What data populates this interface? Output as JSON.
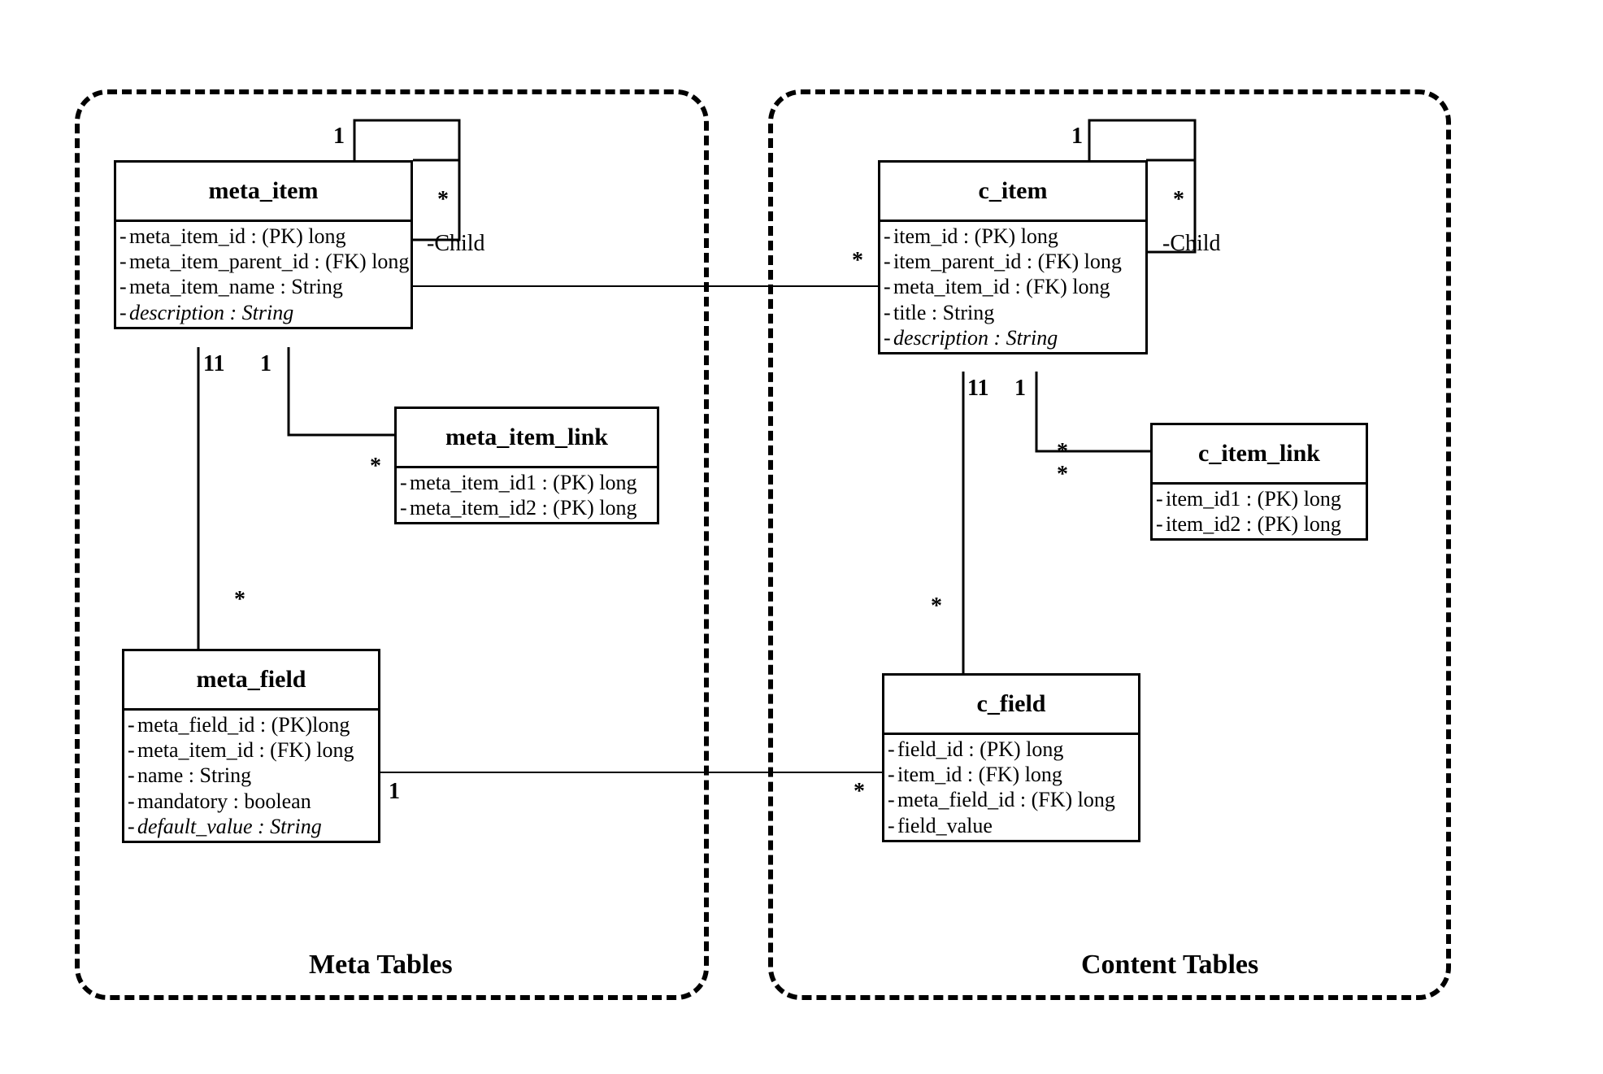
{
  "groups": {
    "meta": {
      "label": "Meta Tables"
    },
    "content": {
      "label": "Content Tables"
    }
  },
  "entities": {
    "meta_item": {
      "name": "meta_item",
      "attrs": [
        {
          "t": "meta_item_id : (PK) long"
        },
        {
          "t": "meta_item_parent_id : (FK) long"
        },
        {
          "t": "meta_item_name : String"
        },
        {
          "t": "description : String",
          "ital": true
        }
      ]
    },
    "meta_item_link": {
      "name": "meta_item_link",
      "attrs": [
        {
          "t": "meta_item_id1 : (PK) long"
        },
        {
          "t": "meta_item_id2 : (PK) long"
        }
      ]
    },
    "meta_field": {
      "name": "meta_field",
      "attrs": [
        {
          "t": "meta_field_id : (PK)long"
        },
        {
          "t": "meta_item_id : (FK) long"
        },
        {
          "t": "name : String"
        },
        {
          "t": "mandatory : boolean"
        },
        {
          "t": "default_value : String",
          "ital": true
        }
      ]
    },
    "c_item": {
      "name": "c_item",
      "attrs": [
        {
          "t": "item_id : (PK) long"
        },
        {
          "t": "item_parent_id : (FK) long"
        },
        {
          "t": "meta_item_id : (FK) long"
        },
        {
          "t": "title : String"
        },
        {
          "t": "description : String",
          "ital": true
        }
      ]
    },
    "c_item_link": {
      "name": "c_item_link",
      "attrs": [
        {
          "t": "item_id1 : (PK) long"
        },
        {
          "t": "item_id2 : (PK) long"
        }
      ]
    },
    "c_field": {
      "name": "c_field",
      "attrs": [
        {
          "t": "field_id : (PK) long"
        },
        {
          "t": "item_id : (FK) long"
        },
        {
          "t": "meta_field_id : (FK) long"
        },
        {
          "t": "field_value"
        }
      ]
    }
  },
  "labels": {
    "child_meta": "-Child",
    "child_content": "-Child"
  },
  "multiplicities": {
    "mi_self_1": "1",
    "mi_self_star": "*",
    "mi_link_1": "1",
    "mi_link_star": "*",
    "mi_field_11": "11",
    "mi_field_star": "*",
    "mi_to_ci_star_left": "*",
    "ci_self_1": "1",
    "ci_self_star": "*",
    "ci_link_1": "1",
    "ci_link_star1": "*",
    "ci_link_star2": "*",
    "ci_field_11": "11",
    "ci_field_star": "*",
    "mf_to_cf_1": "1",
    "mf_to_cf_star": "*"
  }
}
